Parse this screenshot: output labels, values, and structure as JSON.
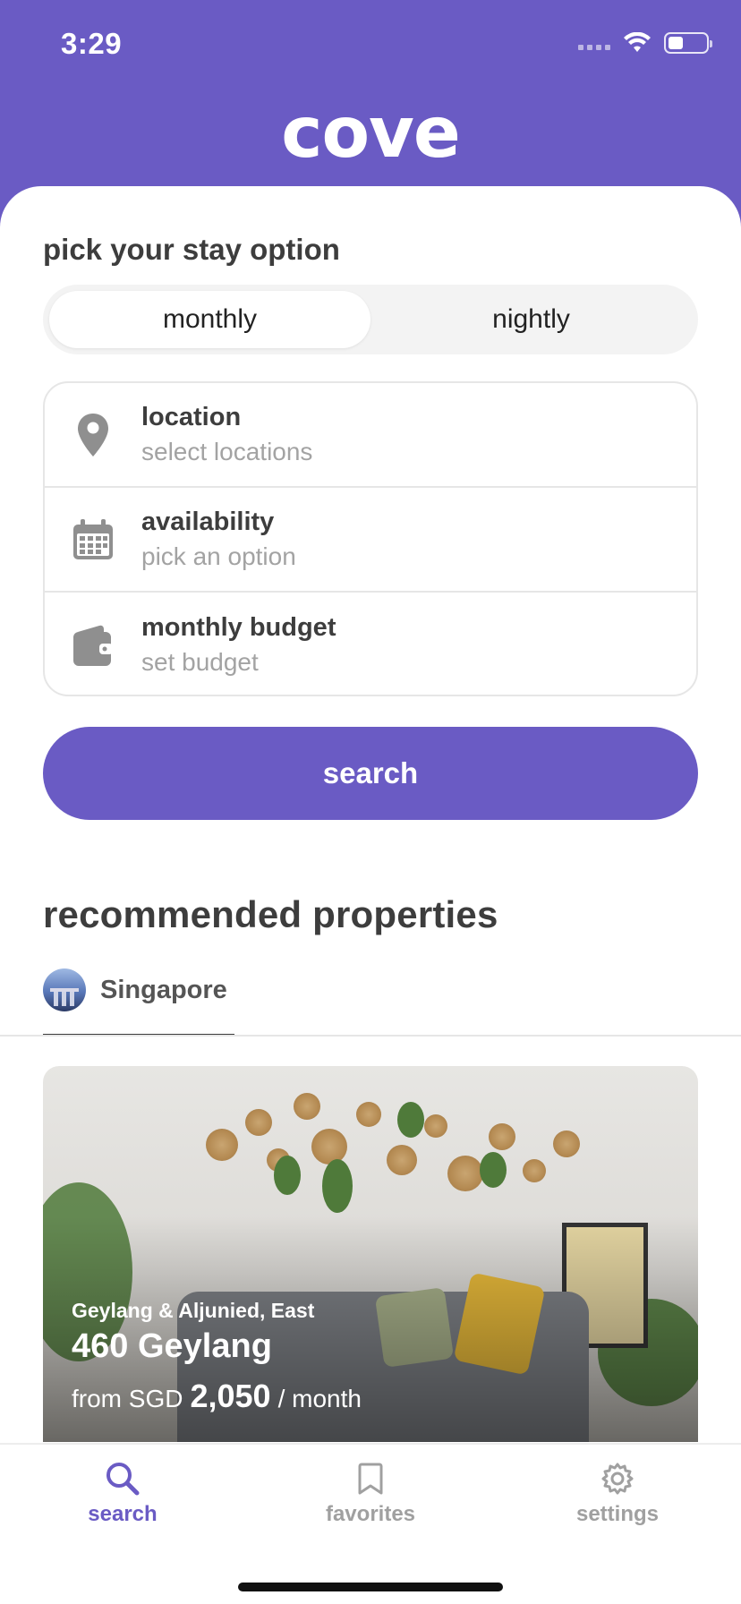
{
  "status": {
    "time": "3:29"
  },
  "app": {
    "logo": "cove",
    "brand_color": "#6a5bc4"
  },
  "stay": {
    "title": "pick your stay option",
    "options": [
      "monthly",
      "nightly"
    ],
    "selected": "monthly"
  },
  "fields": [
    {
      "label": "location",
      "placeholder": "select locations",
      "icon": "location-pin-icon"
    },
    {
      "label": "availability",
      "placeholder": "pick an option",
      "icon": "calendar-icon"
    },
    {
      "label": "monthly budget",
      "placeholder": "set budget",
      "icon": "wallet-icon"
    }
  ],
  "search_button": "search",
  "recommended": {
    "title": "recommended properties",
    "city_tab": "Singapore",
    "card": {
      "area": "Geylang & Aljunied, East",
      "name": "460 Geylang",
      "price_prefix": "from SGD",
      "price": "2,050",
      "price_suffix": "/ month"
    }
  },
  "tabbar": {
    "items": [
      {
        "label": "search",
        "icon": "search-icon",
        "active": true
      },
      {
        "label": "favorites",
        "icon": "bookmark-icon",
        "active": false
      },
      {
        "label": "settings",
        "icon": "gear-icon",
        "active": false
      }
    ]
  }
}
